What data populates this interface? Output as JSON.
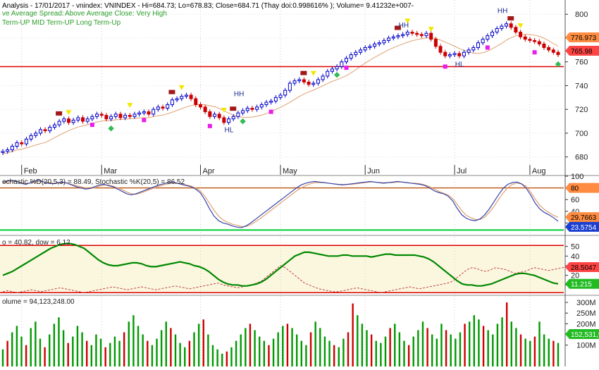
{
  "colors": {
    "up": "#0000cc",
    "down": "#cc0000",
    "support": "#dd0000",
    "ma": "#e0a070",
    "stochD": "#e0a070",
    "stochK": "#3344aa",
    "level80": "#c06020",
    "level20": "#00cc33",
    "dow": "#008800",
    "dowDash": "#c04040",
    "volUp": "#009900",
    "volDown": "#cc0000",
    "tagOrange": "#ff8c40",
    "tagRed": "#ff4444",
    "tagBlue": "#1b3fd0",
    "tagGreen": "#22bb22"
  },
  "header": {
    "line1": "Analysis - 17/01/2017 - vnindex: VNINDEX - Hi=684.73; Lo=678.83; Close=684.71 (Thay doi:0.998616% ); Volume= 9.41232e+007-",
    "line2a": "ve Average Spread:",
    "line2b": "Above Average Close: Very High",
    "line3": "Term-UP MID Term-UP Long Term-Up"
  },
  "x_labels": [
    "Feb",
    "Mar",
    "Apr",
    "May",
    "Jun",
    "Jul",
    "Aug"
  ],
  "chart_data": [
    {
      "type": "candlestick",
      "name": "price",
      "ylim": [
        665,
        812
      ],
      "yticks": [
        680,
        700,
        720,
        740,
        760,
        780,
        800
      ],
      "support_line": 756,
      "last_values": {
        "ma": "776.973",
        "close": "765.98"
      },
      "closes": [
        684.7,
        686,
        689,
        692,
        691,
        695,
        698,
        700,
        703,
        702,
        705,
        707,
        710,
        712,
        709,
        711,
        713,
        710,
        712,
        714,
        716,
        715,
        712,
        714,
        716,
        713,
        715,
        714,
        716,
        717,
        718,
        716,
        720,
        722,
        721,
        724,
        728,
        729,
        731,
        732,
        729,
        724,
        722,
        718,
        714,
        716,
        713,
        709,
        712,
        714,
        717,
        719,
        721,
        720,
        722,
        724,
        726,
        727,
        730,
        732,
        736,
        742,
        744,
        745,
        743,
        741,
        742,
        745,
        748,
        752,
        754,
        756,
        760,
        763,
        766,
        768,
        770,
        772,
        773,
        775,
        776,
        778,
        780,
        781,
        782,
        783,
        785,
        784,
        783,
        782,
        784,
        779,
        773,
        768,
        765,
        766,
        767,
        765,
        768,
        770,
        772,
        776,
        779,
        782,
        785,
        788,
        790,
        792,
        789,
        785,
        781,
        779,
        778,
        777,
        775,
        772,
        770,
        768,
        766
      ],
      "labels": [
        {
          "text": "HH",
          "i": 50,
          "v": 731
        },
        {
          "text": "HH",
          "i": 85,
          "v": 789
        },
        {
          "text": "HH",
          "i": 106,
          "v": 801
        },
        {
          "text": "HL",
          "i": 48,
          "v": 701
        },
        {
          "text": "HL",
          "i": 97,
          "v": 756
        }
      ]
    },
    {
      "type": "line",
      "name": "stochastic",
      "title": "ochastic %D(20,5,3) = 88.49, Stochastic %K(20,5) = 86.52",
      "ylim": [
        0,
        100
      ],
      "yticks": [
        20,
        40,
        60,
        80,
        100
      ],
      "levels": [
        80,
        20
      ],
      "last_values": {
        "d": "29.7663",
        "k": "23.5754",
        "level80": "80"
      },
      "k": [
        90,
        92,
        93,
        91,
        88,
        86,
        89,
        92,
        93,
        90,
        88,
        87,
        89,
        90,
        88,
        85,
        82,
        80,
        78,
        79,
        82,
        85,
        86,
        84,
        82,
        78,
        74,
        70,
        68,
        70,
        73,
        76,
        79,
        82,
        85,
        87,
        89,
        90,
        88,
        86,
        84,
        82,
        78,
        72,
        60,
        45,
        32,
        24,
        20,
        18,
        15,
        13,
        12,
        15,
        20,
        26,
        32,
        38,
        44,
        50,
        56,
        62,
        68,
        74,
        80,
        85,
        88,
        90,
        91,
        90,
        89,
        88,
        87,
        86,
        85,
        86,
        87,
        88,
        89,
        90,
        91,
        90,
        89,
        88,
        89,
        90,
        91,
        90,
        89,
        88,
        87,
        86,
        84,
        80,
        75,
        72,
        70,
        66,
        58,
        45,
        34,
        28,
        25,
        24,
        27,
        34,
        44,
        56,
        68,
        79,
        86,
        89,
        90,
        87,
        80,
        68,
        54,
        44,
        38,
        34,
        29,
        23
      ],
      "d": [
        88,
        90,
        91,
        91,
        89,
        87,
        88,
        90,
        91,
        90,
        89,
        88,
        88,
        89,
        88,
        86,
        84,
        82,
        80,
        79,
        80,
        83,
        85,
        85,
        83,
        80,
        77,
        73,
        70,
        69,
        71,
        74,
        77,
        80,
        83,
        85,
        87,
        88,
        88,
        87,
        85,
        83,
        80,
        75,
        66,
        54,
        42,
        32,
        25,
        21,
        18,
        16,
        14,
        14,
        17,
        22,
        27,
        33,
        39,
        45,
        51,
        57,
        63,
        69,
        75,
        80,
        84,
        87,
        89,
        89,
        89,
        88,
        87,
        86,
        86,
        86,
        86,
        87,
        88,
        89,
        90,
        90,
        89,
        89,
        89,
        89,
        90,
        90,
        89,
        88,
        88,
        87,
        85,
        82,
        78,
        74,
        71,
        68,
        62,
        52,
        41,
        33,
        29,
        26,
        26,
        30,
        38,
        48,
        60,
        71,
        80,
        86,
        88,
        87,
        83,
        73,
        61,
        50,
        43,
        38,
        33,
        29.8
      ]
    },
    {
      "type": "line",
      "name": "dow",
      "title": "o = 40.82, dow = 6.12",
      "ylim": [
        0,
        60
      ],
      "yticks": [
        10,
        20,
        30,
        40,
        50
      ],
      "levels": [
        51,
        2
      ],
      "last_values": {
        "dash": "28.5047",
        "line": "11.215"
      },
      "line": [
        20,
        22,
        24,
        27,
        30,
        33,
        36,
        39,
        42,
        45,
        48,
        50,
        52,
        53,
        53,
        52,
        50,
        48,
        44,
        40,
        36,
        33,
        31,
        30,
        30,
        31,
        32,
        33,
        33,
        32,
        30,
        29,
        29,
        30,
        31,
        32,
        33,
        34,
        33,
        32,
        30,
        29,
        27,
        24,
        20,
        16,
        13,
        11,
        10,
        10,
        9,
        9,
        10,
        11,
        13,
        16,
        20,
        24,
        28,
        32,
        36,
        40,
        42,
        44,
        44,
        43,
        42,
        41,
        40,
        40,
        40,
        41,
        41,
        40,
        40,
        40,
        40,
        39,
        40,
        41,
        42,
        42,
        41,
        41,
        41,
        41,
        41,
        40,
        39,
        37,
        34,
        30,
        26,
        22,
        18,
        14,
        11,
        10,
        10,
        9,
        9,
        10,
        11,
        13,
        15,
        17,
        19,
        21,
        22,
        22,
        21,
        20,
        18,
        16,
        14,
        12,
        11.2
      ],
      "dash": [
        3,
        4,
        3,
        2,
        3,
        4,
        5,
        4,
        3,
        4,
        5,
        6,
        7,
        6,
        5,
        4,
        3,
        2,
        3,
        4,
        5,
        6,
        7,
        8,
        7,
        6,
        5,
        6,
        7,
        8,
        7,
        6,
        5,
        6,
        7,
        8,
        9,
        8,
        7,
        6,
        7,
        8,
        9,
        10,
        11,
        12,
        10,
        9,
        8,
        7,
        8,
        9,
        10,
        12,
        14,
        18,
        22,
        26,
        30,
        28,
        24,
        20,
        16,
        12,
        10,
        8,
        6,
        5,
        4,
        3,
        3,
        4,
        5,
        6,
        7,
        6,
        5,
        4,
        3,
        2,
        3,
        4,
        5,
        6,
        7,
        8,
        7,
        6,
        7,
        8,
        9,
        10,
        11,
        12,
        14,
        18,
        22,
        26,
        28,
        27,
        25,
        24,
        26,
        28,
        27,
        26,
        24,
        22,
        23,
        24,
        26,
        28,
        27,
        26,
        25,
        26,
        27,
        28,
        28.5
      ]
    },
    {
      "type": "bar",
      "name": "volume",
      "title": "olume = 94,123,248.00",
      "ylim": [
        0,
        330
      ],
      "yticks": [
        "100M",
        "150M",
        "200M",
        "250M",
        "300M"
      ],
      "last_value": "152,531,9",
      "values": [
        80,
        120,
        160,
        190,
        140,
        100,
        180,
        210,
        130,
        90,
        150,
        200,
        230,
        170,
        110,
        140,
        190,
        160,
        120,
        100,
        150,
        130,
        90,
        110,
        140,
        120,
        160,
        210,
        240,
        190,
        150,
        120,
        100,
        130,
        170,
        210,
        180,
        150,
        110,
        90,
        120,
        160,
        200,
        220,
        150,
        100,
        80,
        60,
        70,
        90,
        120,
        150,
        180,
        200,
        170,
        140,
        120,
        100,
        130,
        160,
        190,
        200,
        180,
        150,
        120,
        100,
        160,
        210,
        180,
        140,
        120,
        100,
        90,
        130,
        160,
        220,
        240,
        200,
        170,
        150,
        120,
        110,
        140,
        180,
        200,
        160,
        120,
        100,
        140,
        170,
        210,
        180,
        150,
        130,
        200,
        170,
        150,
        130,
        160,
        200,
        210,
        240,
        220,
        190,
        170,
        150,
        200,
        230,
        300,
        210,
        180,
        150,
        130,
        120,
        140,
        210,
        150,
        130,
        120,
        110
      ],
      "down": [
        1,
        5,
        9,
        14,
        18,
        22,
        26,
        31,
        36,
        40,
        43,
        48,
        53,
        57,
        61,
        66,
        71,
        74,
        79,
        83,
        87,
        91,
        95,
        99,
        103,
        108,
        111,
        114,
        118
      ],
      "spikes": [
        {
          "i": 75,
          "v": 295
        },
        {
          "i": 108,
          "v": 300
        }
      ]
    }
  ]
}
